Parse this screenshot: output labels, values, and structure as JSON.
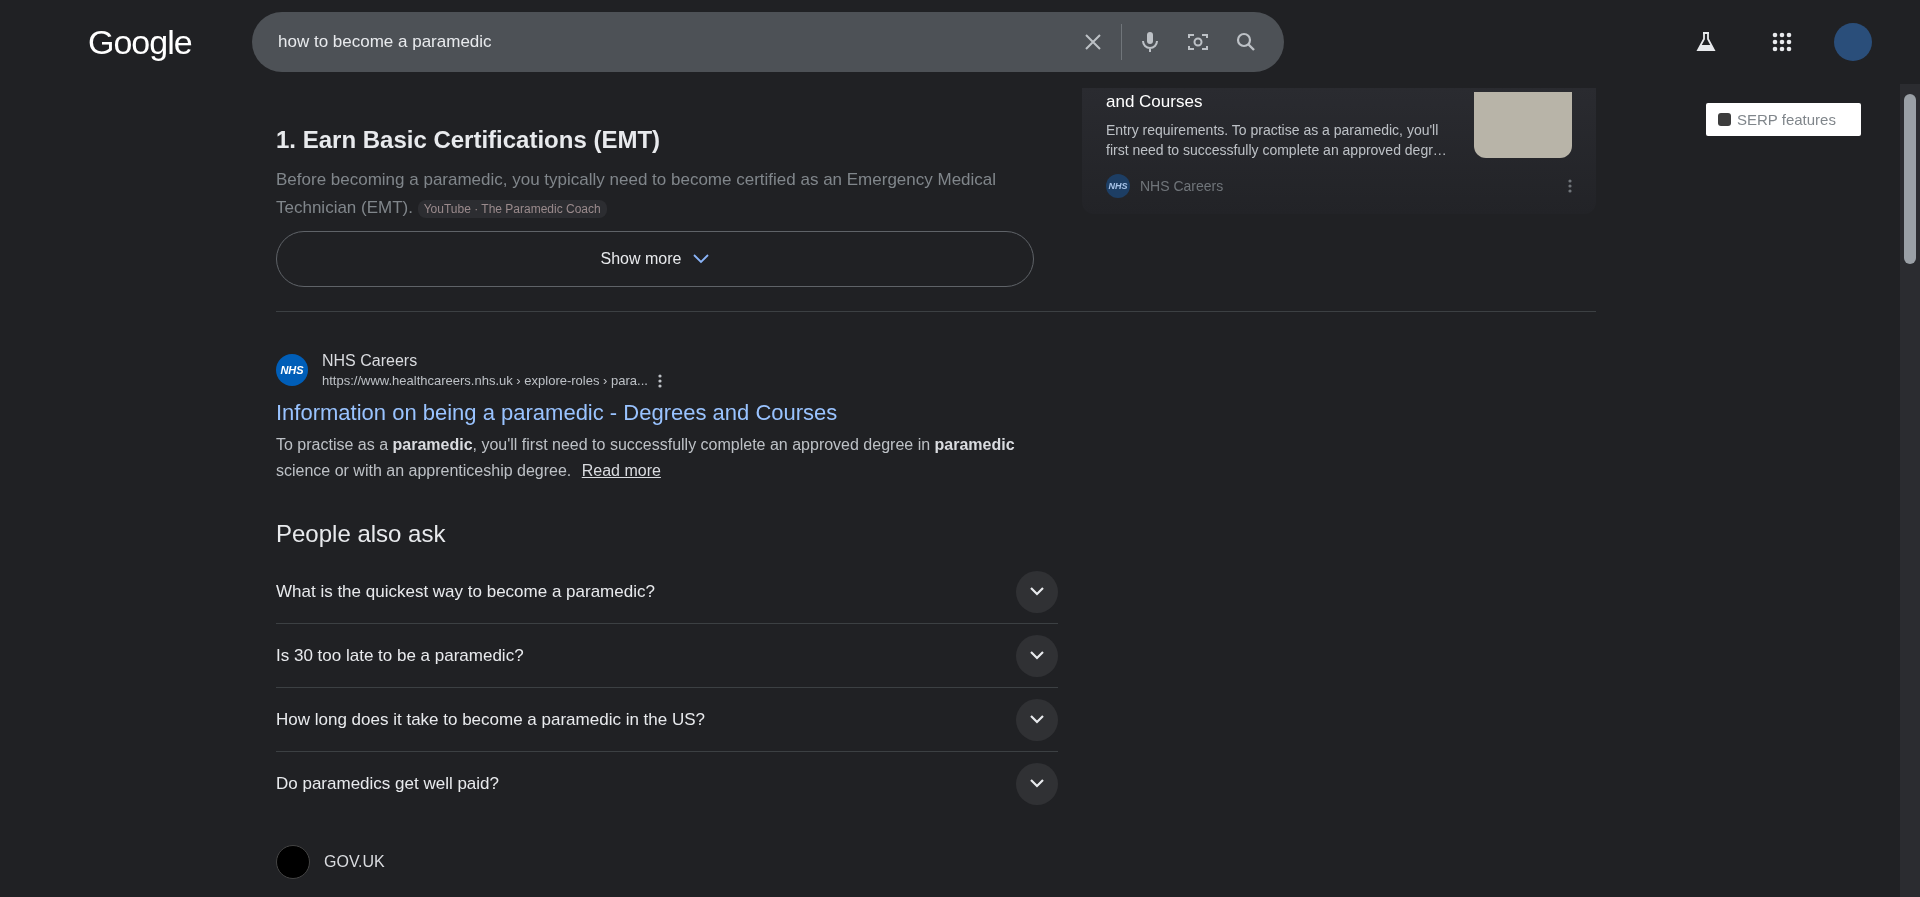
{
  "header": {
    "logo": "Google",
    "search": {
      "value": "how to become a paramedic"
    }
  },
  "ai_overview": {
    "heading": "1. Earn Basic Certifications (EMT)",
    "text": "Before becoming a paramedic, you typically need to become certified as an Emergency Medical Technician (EMT).",
    "source_chip": "YouTube · The Paramedic Coach",
    "show_more": "Show more"
  },
  "result": {
    "favicon": "NHS",
    "site": "NHS Careers",
    "url": "https://www.healthcareers.nhs.uk › explore-roles › para...",
    "title": "Information on being a paramedic - Degrees and Courses",
    "snippet": "To practise as a **paramedic**, you'll first need to successfully complete an approved degree in **paramedic** science or with an apprenticeship degree.",
    "read_more": "Read more"
  },
  "people_also_ask": {
    "heading": "People also ask",
    "questions": [
      {
        "text": "What is the quickest way to become a paramedic?"
      },
      {
        "text": "Is 30 too late to be a paramedic?"
      },
      {
        "text": "How long does it take to become a paramedic in the US?"
      },
      {
        "text": "Do paramedics get well paid?"
      }
    ]
  },
  "next_result": {
    "site": "GOV.UK"
  },
  "side_card": {
    "title": "and Courses",
    "snippet": "Entry requirements. To practise as a paramedic, you'll first need to successfully complete an approved degr…",
    "favicon": "NHS",
    "source": "NHS Careers"
  },
  "serp_features": {
    "label": "SERP features",
    "checked": false
  }
}
